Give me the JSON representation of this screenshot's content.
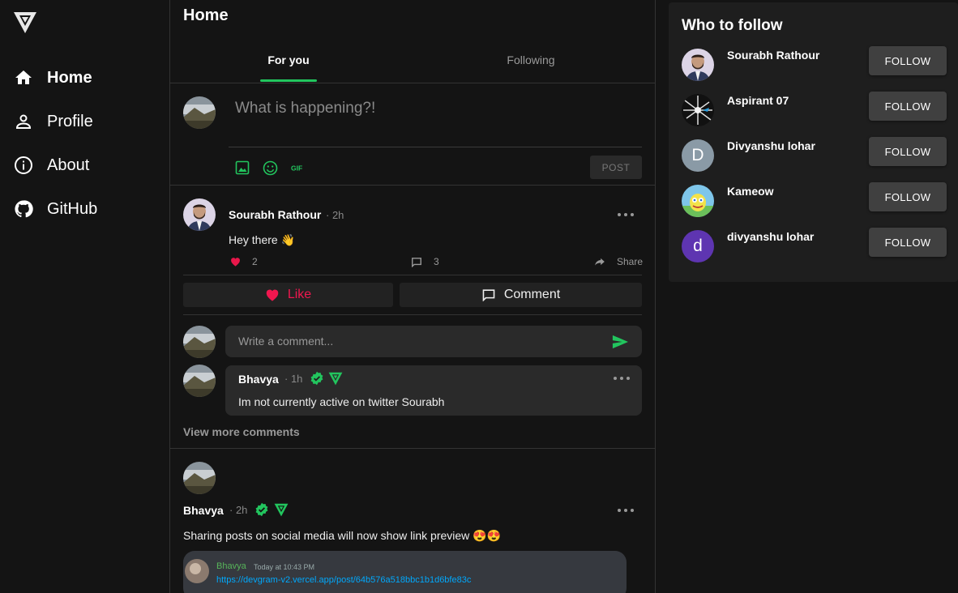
{
  "sidebar": {
    "items": [
      {
        "label": "Home",
        "icon": "home-icon"
      },
      {
        "label": "Profile",
        "icon": "person-icon"
      },
      {
        "label": "About",
        "icon": "info-icon"
      },
      {
        "label": "GitHub",
        "icon": "github-icon"
      }
    ]
  },
  "feed": {
    "title": "Home",
    "tabs": [
      {
        "label": "For you"
      },
      {
        "label": "Following"
      }
    ],
    "compose": {
      "placeholder": "What is happening?!",
      "post_label": "POST"
    }
  },
  "post1": {
    "author": "Sourabh Rathour",
    "time": "· 2h",
    "text": "Hey there 👋",
    "likes": "2",
    "comments": "3",
    "share_label": "Share",
    "like_label": "Like",
    "comment_label": "Comment",
    "comment_placeholder": "Write a comment...",
    "comment": {
      "author": "Bhavya",
      "time": "· 1h",
      "text": "Im not currently active on twitter Sourabh"
    },
    "view_more": "View more comments"
  },
  "post2": {
    "author": "Bhavya",
    "time": "· 2h",
    "text": "Sharing posts on social media will now show link preview 😍😍",
    "preview": {
      "user": "Bhavya",
      "time": "Today at 10:43 PM",
      "link": "https://devgram-v2.vercel.app/post/64b576a518bbc1b1d6bfe83c"
    }
  },
  "who_to_follow": {
    "title": "Who to follow",
    "button_label": "FOLLOW",
    "users": [
      {
        "name": "Sourabh Rathour",
        "initial": ""
      },
      {
        "name": "Aspirant 07",
        "initial": ""
      },
      {
        "name": "Divyanshu lohar",
        "initial": "D"
      },
      {
        "name": "Kameow",
        "initial": ""
      },
      {
        "name": "divyanshu lohar",
        "initial": "d"
      }
    ]
  },
  "colors": {
    "accent": "#22c55e",
    "like": "#f0174f",
    "link": "#00a8fc"
  }
}
